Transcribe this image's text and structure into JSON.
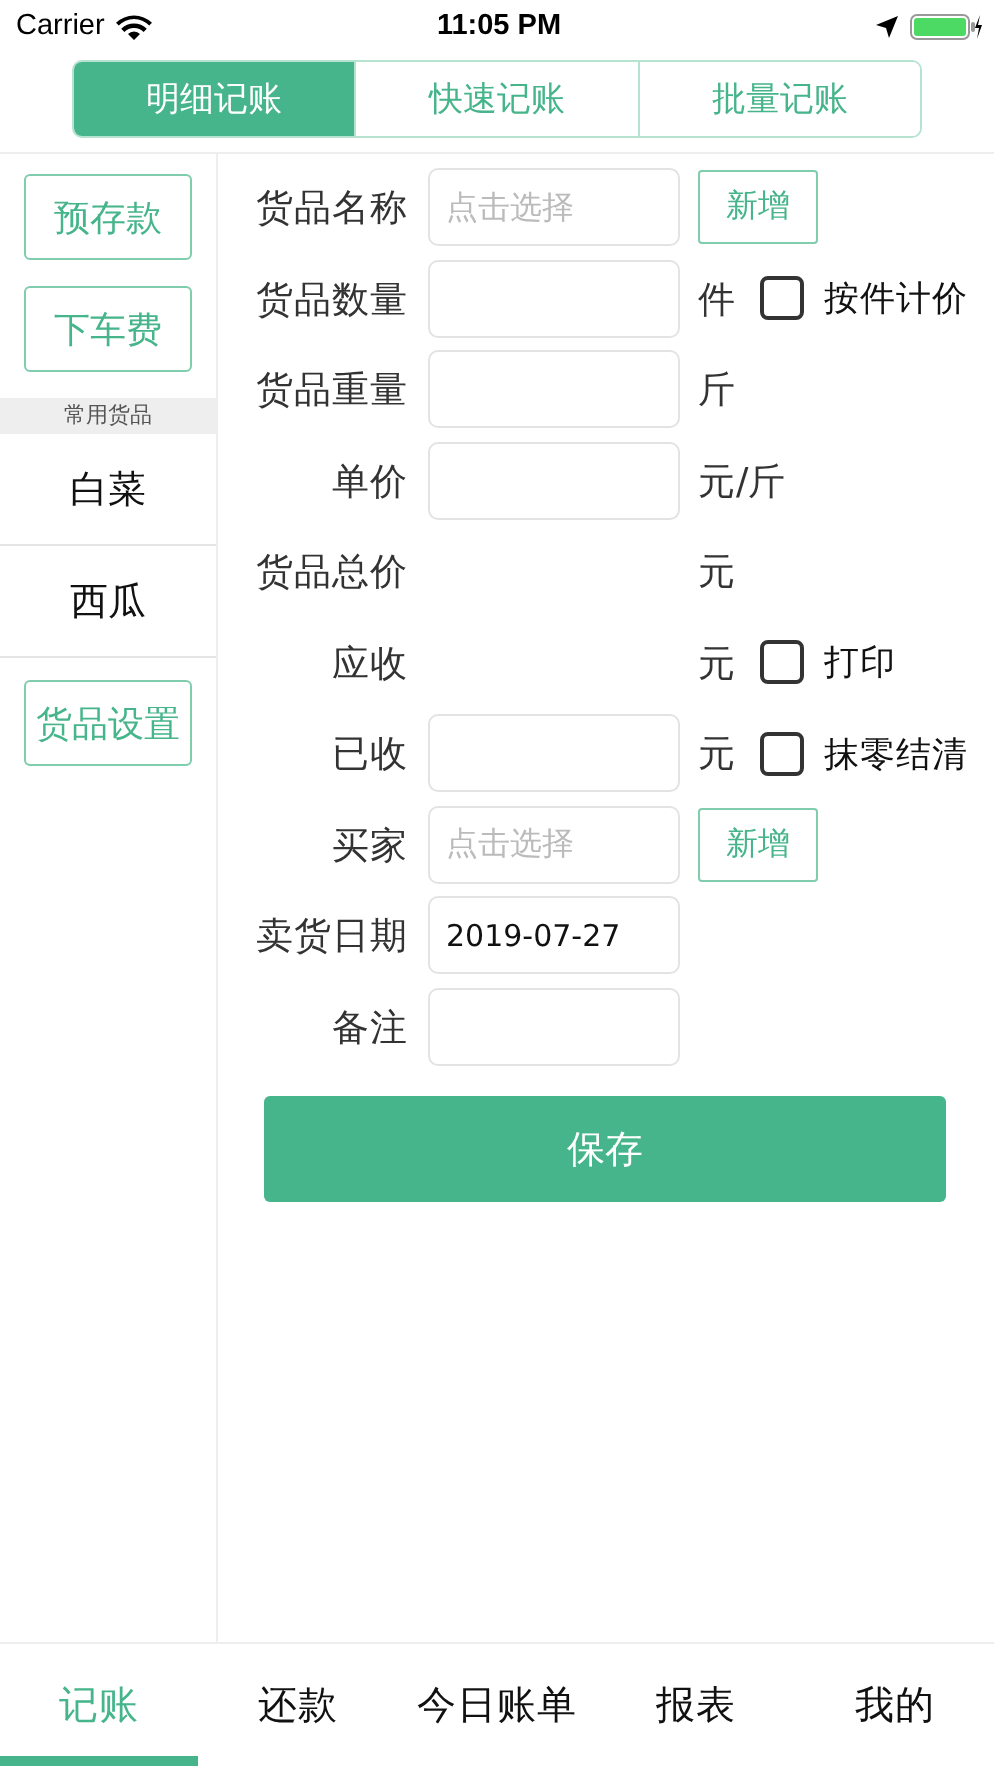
{
  "status_bar": {
    "carrier": "Carrier",
    "time": "11:05 PM"
  },
  "segments": [
    {
      "label": "明细记账",
      "selected": true
    },
    {
      "label": "快速记账",
      "selected": false
    },
    {
      "label": "批量记账",
      "selected": false
    }
  ],
  "sidebar": {
    "buttons_top": [
      "预存款",
      "下车费"
    ],
    "section_title": "常用货品",
    "items": [
      "白菜",
      "西瓜"
    ],
    "buttons_bottom": [
      "货品设置"
    ]
  },
  "form": [
    {
      "label": "货品名称",
      "kind": "input",
      "placeholder": "点击选择",
      "button": "新增"
    },
    {
      "label": "货品数量",
      "kind": "input",
      "unit": "件",
      "checkbox": {
        "label": "按件计价",
        "checked": false
      }
    },
    {
      "label": "货品重量",
      "kind": "input",
      "unit": "斤"
    },
    {
      "label": "单价",
      "kind": "input",
      "unit": "元/斤"
    },
    {
      "label": "货品总价",
      "kind": "text",
      "unit": "元"
    },
    {
      "label": "应收",
      "kind": "text",
      "unit": "元",
      "checkbox": {
        "label": "打印",
        "checked": false
      }
    },
    {
      "label": "已收",
      "kind": "input",
      "unit": "元",
      "checkbox": {
        "label": "抹零结清",
        "checked": false
      }
    },
    {
      "label": "买家",
      "kind": "input",
      "placeholder": "点击选择",
      "button": "新增"
    },
    {
      "label": "卖货日期",
      "kind": "input",
      "value": "2019-07-27"
    },
    {
      "label": "备注",
      "kind": "input"
    }
  ],
  "save_button": "保存",
  "tab_bar": [
    {
      "label": "记账",
      "selected": true
    },
    {
      "label": "还款",
      "selected": false
    },
    {
      "label": "今日账单",
      "selected": false
    },
    {
      "label": "报表",
      "selected": false
    },
    {
      "label": "我的",
      "selected": false
    }
  ]
}
